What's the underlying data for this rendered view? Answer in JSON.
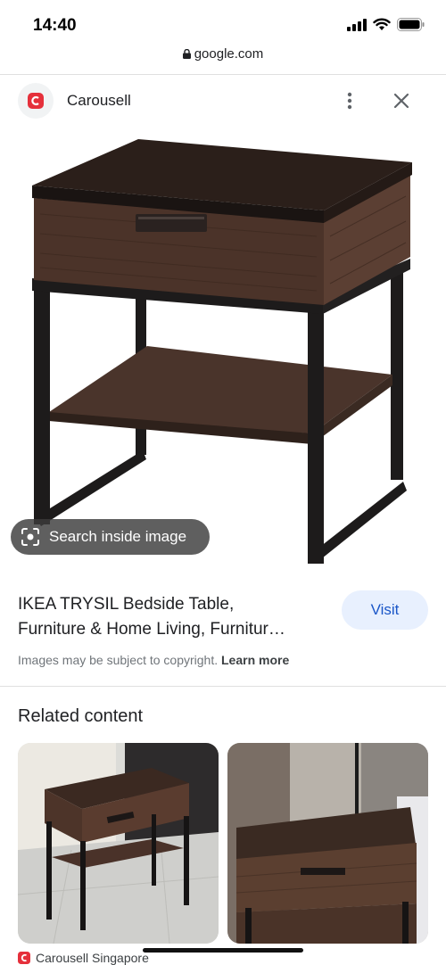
{
  "status_bar": {
    "time": "14:40"
  },
  "browser": {
    "url": "google.com"
  },
  "source": {
    "name": "Carousell"
  },
  "image_overlay": {
    "search_label": "Search inside image"
  },
  "result": {
    "title_line1": "IKEA TRYSIL Bedside Table,",
    "title_line2": "Furniture & Home Living, Furnitur…",
    "visit_label": "Visit",
    "copyright_text": "Images may be subject to copyright.",
    "learn_more_label": "Learn more"
  },
  "related": {
    "heading": "Related content",
    "items": [
      {
        "source": "Carousell Singapore"
      },
      {
        "source": ""
      }
    ]
  },
  "colors": {
    "accent": "#1a56c8",
    "visit_bg": "#e8f0fe",
    "brand": "#e5303b"
  },
  "icons": [
    "lock-icon",
    "more-vert-icon",
    "close-icon",
    "lens-icon",
    "signal-icon",
    "wifi-icon",
    "battery-icon"
  ]
}
